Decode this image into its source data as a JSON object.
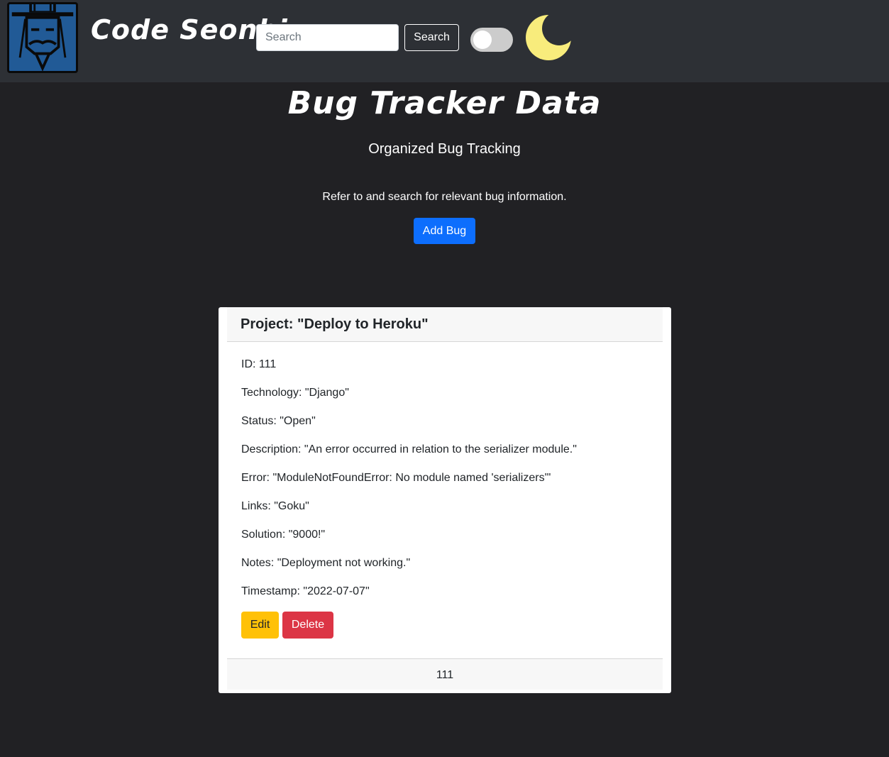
{
  "navbar": {
    "logo_icon": "seonbi-scholar-icon",
    "brand": "Code Seonbi",
    "search_placeholder": "Search",
    "search_value": "",
    "search_button": "Search",
    "theme_toggle_on": false,
    "theme_icon": "moon-icon"
  },
  "hero": {
    "title": "Bug Tracker Data",
    "subtitle": "Organized Bug Tracking",
    "lead": "Refer to and search for relevant bug information.",
    "add_button": "Add Bug"
  },
  "bug": {
    "header": "Project: \"Deploy to Heroku\"",
    "fields": [
      "ID: 111",
      "Technology: \"Django\"",
      "Status: \"Open\"",
      "Description: \"An error occurred in relation to the serializer module.\"",
      "Error: \"ModuleNotFoundError: No module named 'serializers'\"",
      "Links: \"Goku\"",
      "Solution: \"9000!\"",
      "Notes: \"Deployment not working.\"",
      "Timestamp: \"2022-07-07\""
    ],
    "edit_button": "Edit",
    "delete_button": "Delete",
    "footer": "111"
  },
  "colors": {
    "background": "#212124",
    "navbar": "#2d3035",
    "primary": "#0d6efd",
    "warning": "#ffc107",
    "danger": "#dc3545",
    "moon": "#f8ec7c",
    "logo": "#215a96"
  }
}
